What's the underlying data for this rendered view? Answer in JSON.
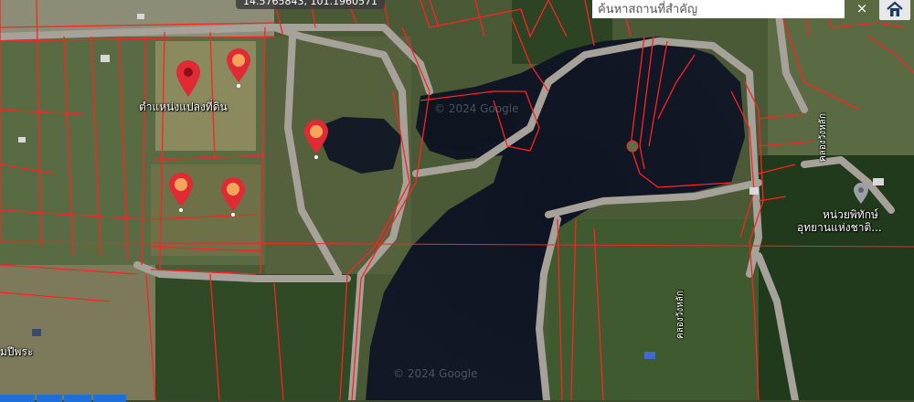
{
  "map": {
    "coordinates": "14.5765843, 101.1960571",
    "search_placeholder": "ค้นหาสถานที่สำคัญ",
    "close_symbol": "×",
    "pin_label": "ตำแหน่งแปลงที่ดิน",
    "place_label": "หน่วยพิทักษ์\nอุทยานแห่งชาติ...",
    "place_label_line1": "หน่วยพิทักษ์",
    "place_label_line2": "อุทยานแห่งชาติ...",
    "road_label_1": "คลองวังหลัก",
    "road_label_2": "คลองวังหลัก",
    "area_label": "มปีพระ",
    "watermark_1": "© 2024 Google",
    "watermark_2": "© 2024 Google",
    "pin_color": "#e02a34",
    "selected_pin_fill": "#f5a55a",
    "boundary_color": "#ff2222"
  }
}
